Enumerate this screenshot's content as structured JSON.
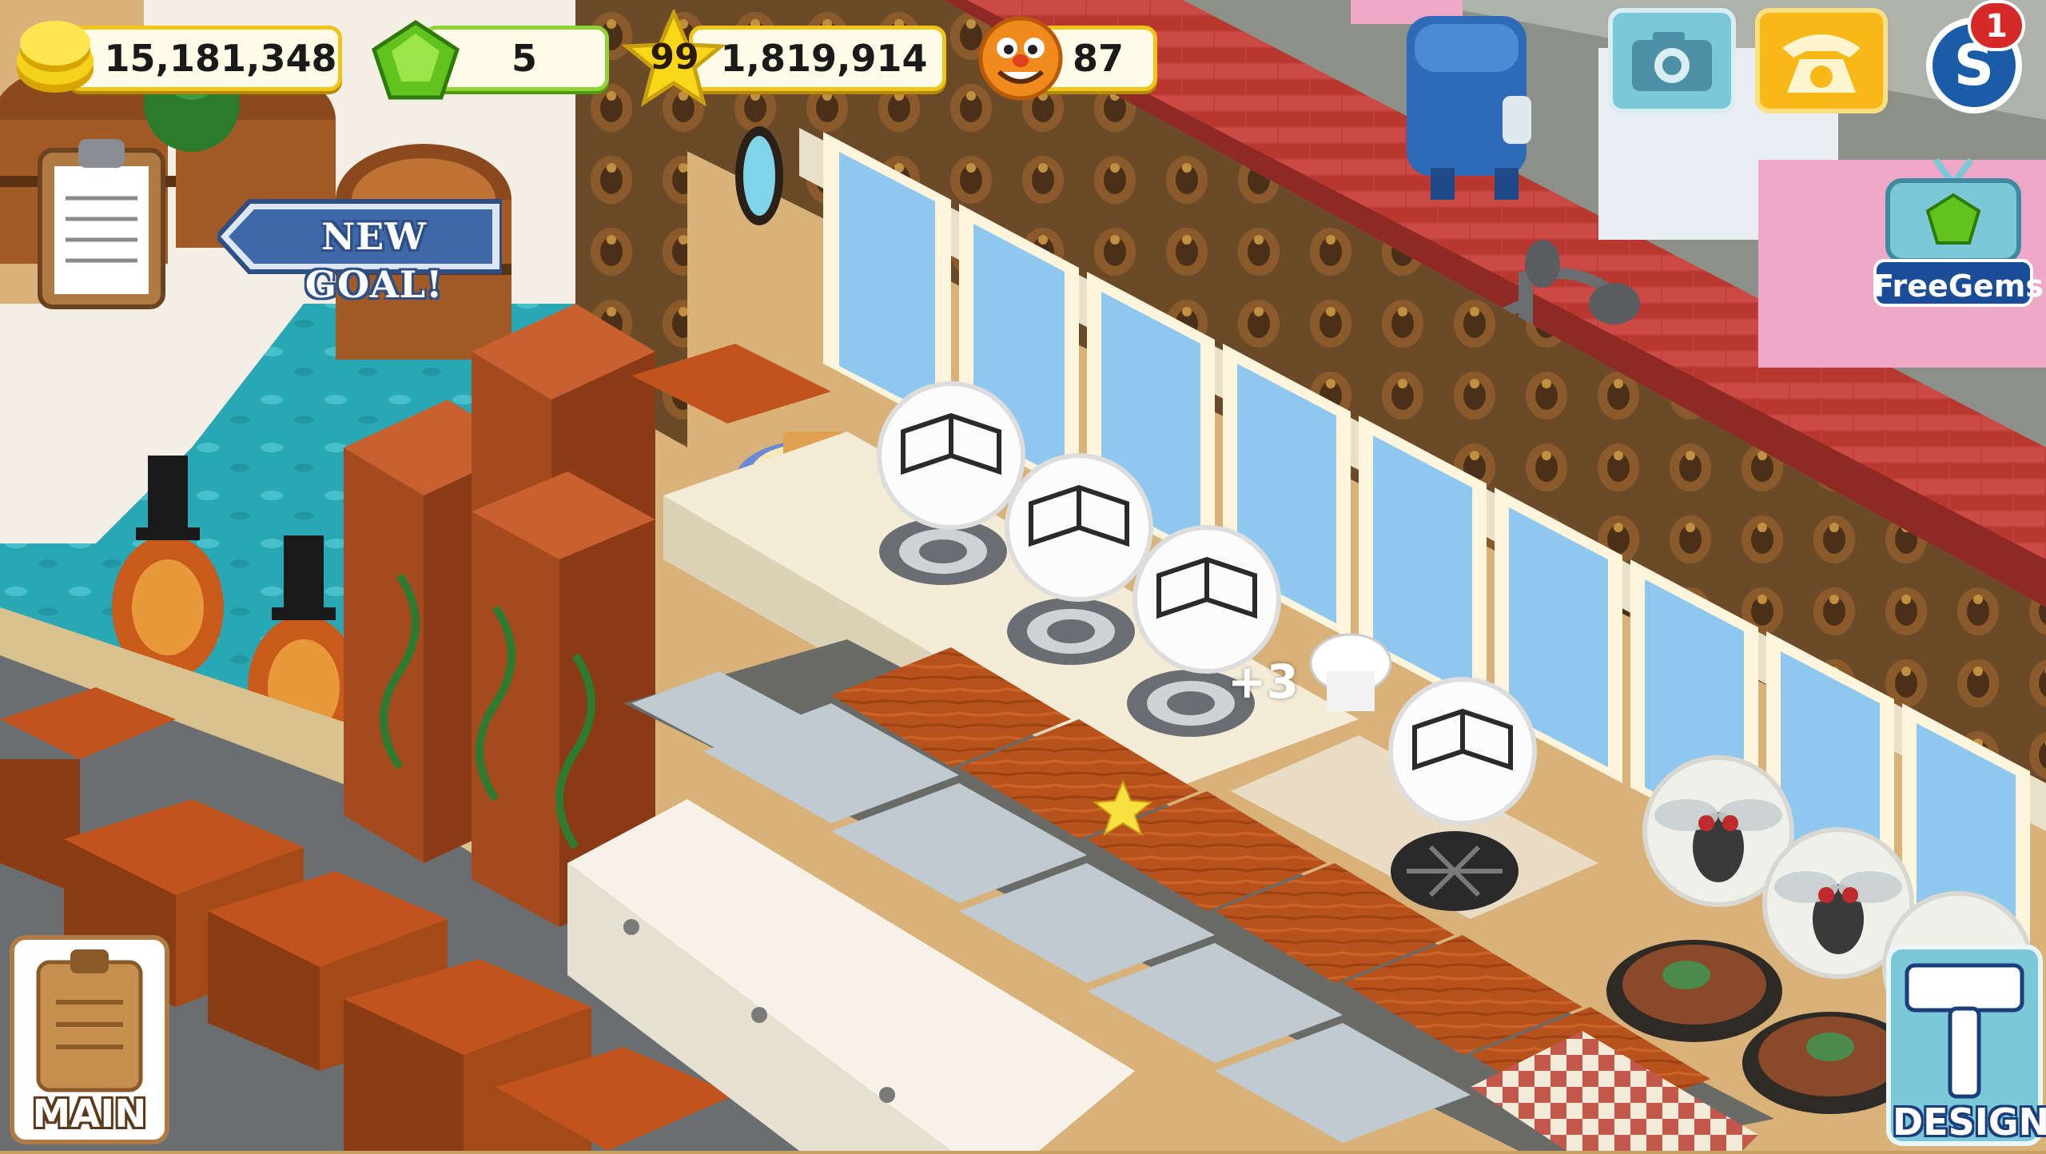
{
  "hud": {
    "coins": "15,181,348",
    "gems": "5",
    "level": "99",
    "experience": "1,819,914",
    "customers": "87"
  },
  "goal_banner": {
    "text": "NEW GOAL!"
  },
  "notifications": {
    "badge_count": "1"
  },
  "free_gems": {
    "label": "FreeGems"
  },
  "cooking": {
    "ready_plus": "+3"
  },
  "buttons": {
    "main_label": "MAIN",
    "design_label": "DESIGN"
  },
  "icons": {
    "coin": "coin-icon",
    "gem": "gem-icon",
    "star": "star-icon",
    "face": "customer-face-icon",
    "camera": "camera-icon",
    "phone": "phone-icon",
    "social": "social-icon",
    "clipboard": "clipboard-icon",
    "hammer": "hammer-icon",
    "recipe": "recipe-book-icon",
    "fly": "fly-icon"
  },
  "colors": {
    "hud_border": "#f0c418",
    "gem_border": "#8fd23a",
    "goal_blue": "#3f68a8",
    "wall_red": "#c43c3c",
    "counter_wood": "#b8521c",
    "floor_teal": "#2aa7b4"
  }
}
